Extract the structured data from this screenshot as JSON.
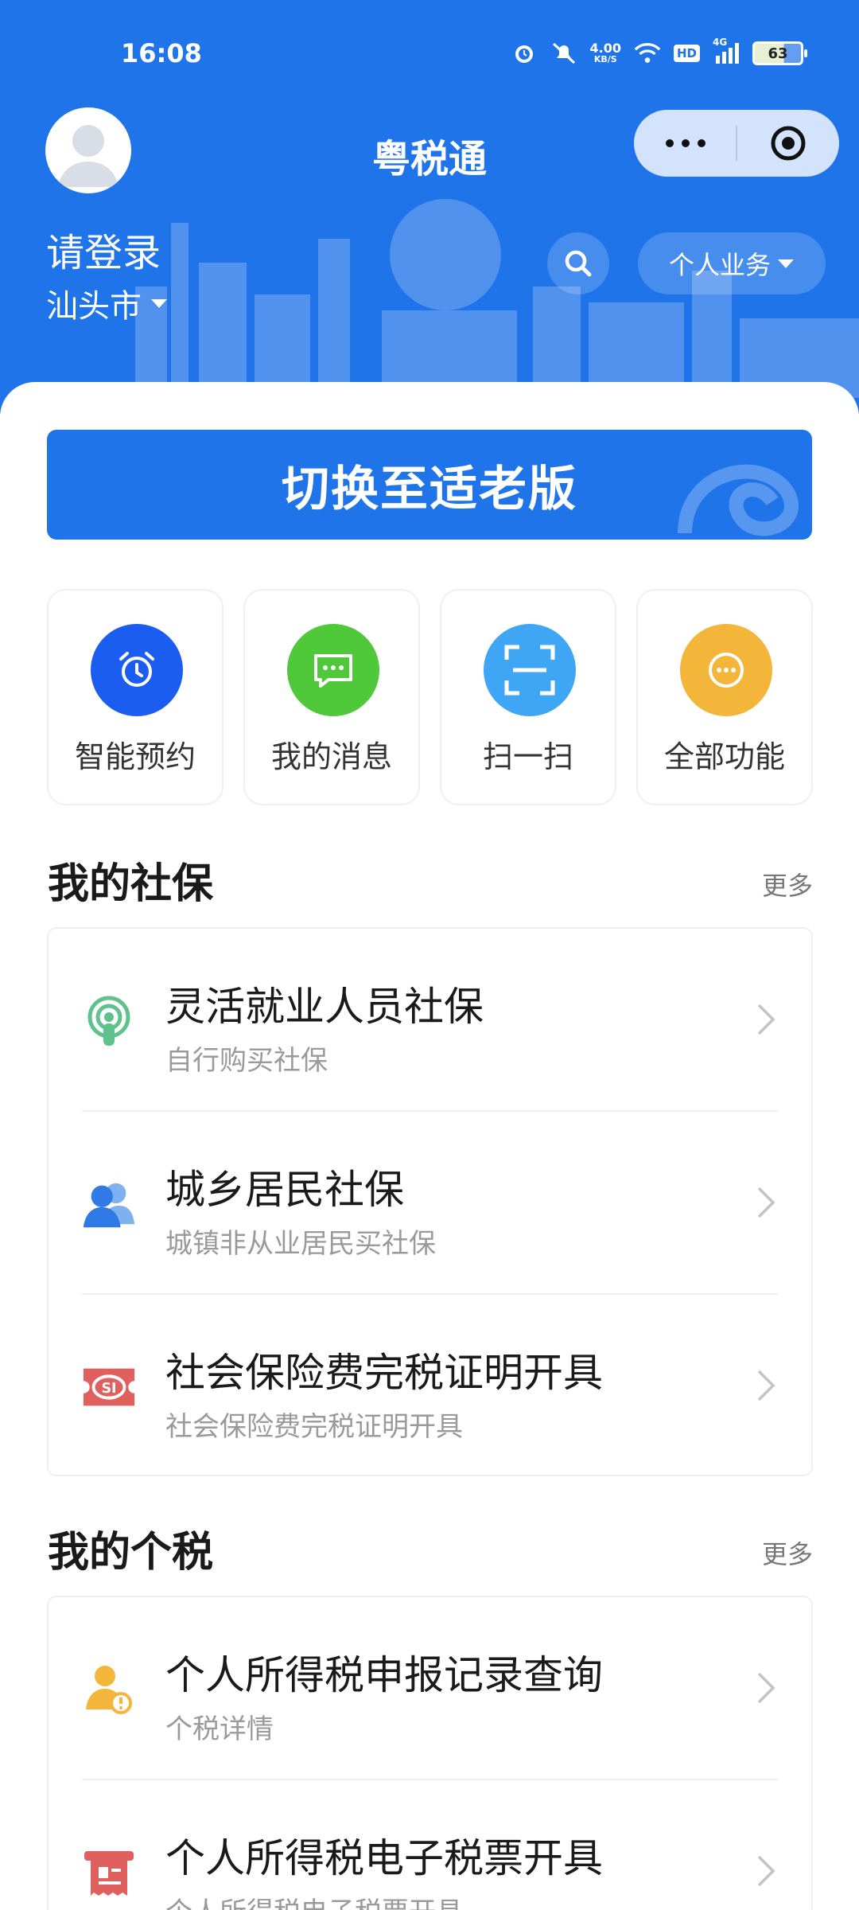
{
  "status_bar": {
    "time": "16:08",
    "net_speed_value": "4.00",
    "net_speed_unit": "KB/S",
    "hd": "HD",
    "network": "4G",
    "battery": "63"
  },
  "header": {
    "app_title": "粤税通",
    "login_text": "请登录",
    "city": "汕头市",
    "business_label": "个人业务"
  },
  "switch_button": {
    "label": "切换至适老版"
  },
  "quick_actions": [
    {
      "label": "智能预约",
      "icon": "alarm-clock-icon",
      "color": "#1a5df0"
    },
    {
      "label": "我的消息",
      "icon": "message-icon",
      "color": "#4fc93a"
    },
    {
      "label": "扫一扫",
      "icon": "scan-icon",
      "color": "#3fa6f5"
    },
    {
      "label": "全部功能",
      "icon": "more-icon",
      "color": "#f3b63b"
    }
  ],
  "social_security": {
    "title": "我的社保",
    "more": "更多",
    "items": [
      {
        "title": "灵活就业人员社保",
        "subtitle": "自行购买社保",
        "icon": "person-signal-icon"
      },
      {
        "title": "城乡居民社保",
        "subtitle": "城镇非从业居民买社保",
        "icon": "users-icon"
      },
      {
        "title": "社会保险费完税证明开具",
        "subtitle": "社会保险费完税证明开具",
        "icon": "si-certificate-icon"
      }
    ]
  },
  "personal_tax": {
    "title": "我的个税",
    "more": "更多",
    "items": [
      {
        "title": "个人所得税申报记录查询",
        "subtitle": "个税详情",
        "icon": "person-tax-icon"
      },
      {
        "title": "个人所得税电子税票开具",
        "subtitle": "个人所得税电子税票开具",
        "icon": "tax-receipt-icon"
      }
    ]
  }
}
